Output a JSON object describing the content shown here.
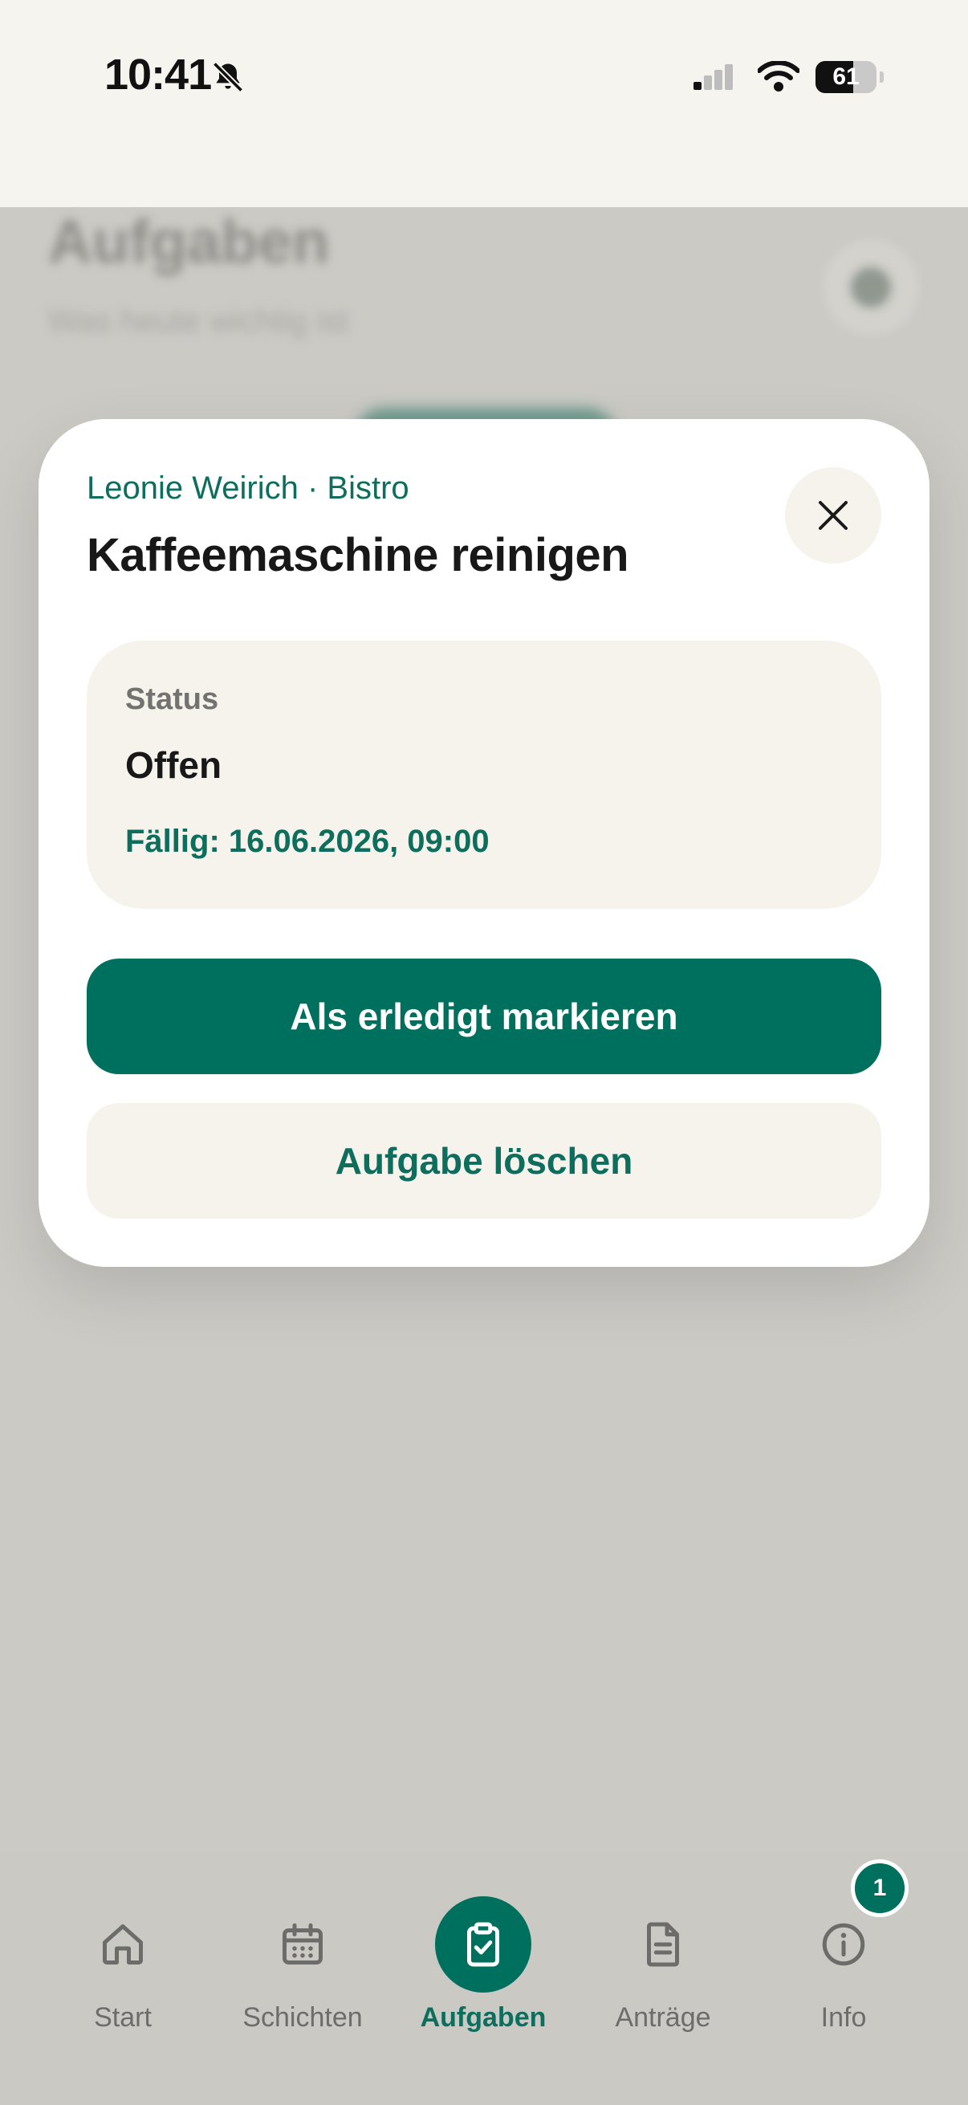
{
  "status_bar": {
    "time": "10:41",
    "battery_level": "61",
    "icons": [
      "bell-slash-icon",
      "cellular-signal-icon",
      "wifi-icon",
      "battery-icon"
    ]
  },
  "background_page": {
    "title": "Aufgaben",
    "subtitle": "Was heute wichtig ist"
  },
  "modal": {
    "eyebrow": "Leonie Weirich · Bistro",
    "title": "Kaffeemaschine reinigen",
    "close_icon": "close-icon",
    "status_card": {
      "label": "Status",
      "value": "Offen",
      "due": "Fällig: 16.06.2026, 09:00"
    },
    "primary_button": "Als erledigt markieren",
    "secondary_button": "Aufgabe löschen"
  },
  "tabbar": {
    "tabs": [
      {
        "label": "Start",
        "icon": "home-icon"
      },
      {
        "label": "Schichten",
        "icon": "calendar-icon"
      },
      {
        "label": "Aufgaben",
        "icon": "clipboard-check-icon",
        "active": true
      },
      {
        "label": "Anträge",
        "icon": "document-icon"
      },
      {
        "label": "Info",
        "icon": "info-icon",
        "badge": "1"
      }
    ]
  },
  "colors": {
    "accent": "#00705e",
    "accent_text": "#0d6e5d",
    "card_bg": "#f6f3ed",
    "overlay_bg": "#cbcac5"
  }
}
